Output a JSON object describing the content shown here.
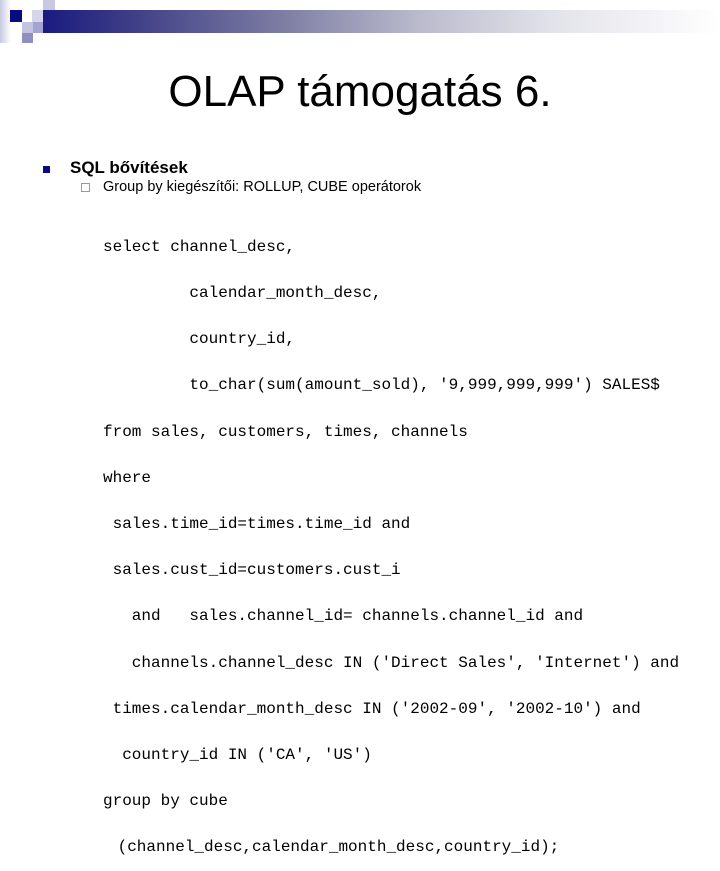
{
  "slide": {
    "title": "OLAP támogatás 6.",
    "bullets": [
      {
        "level": 1,
        "text": "SQL bővítések",
        "bullet_color": "#0a0a80"
      },
      {
        "level": 2,
        "text": "Group by kiegészítői: ROLLUP, CUBE operátorok"
      }
    ],
    "code_lines": [
      "select channel_desc,",
      "         calendar_month_desc,",
      "         country_id,",
      "         to_char(sum(amount_sold), '9,999,999,999') SALES$",
      "from sales, customers, times, channels",
      "where",
      " sales.time_id=times.time_id and",
      " sales.cust_id=customers.cust_i",
      "   and   sales.channel_id= channels.channel_id and",
      "   channels.channel_desc IN ('Direct Sales', 'Internet') and",
      " times.calendar_month_desc IN ('2002-09', '2002-10') and",
      "  country_id IN ('CA', 'US')",
      "group by cube",
      " (channel_desc,calendar_month_desc,country_id);"
    ]
  },
  "theme": {
    "accent": "#1a1a80",
    "text": "#000000"
  }
}
